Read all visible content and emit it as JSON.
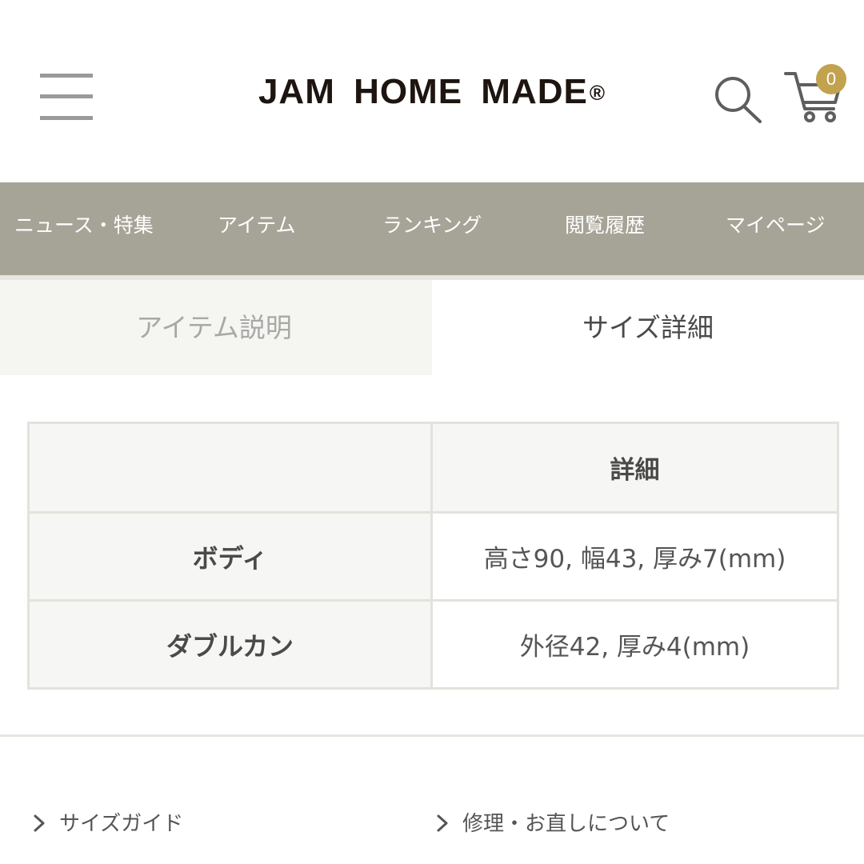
{
  "header": {
    "logo_text": "JAM HOME MADE",
    "logo_mark": "®",
    "cart_count": "0",
    "icons": [
      "hamburger-menu-icon",
      "search-icon",
      "cart-icon"
    ],
    "accent_color": "#c2a24f"
  },
  "nav": {
    "background": "#a6a497",
    "items": [
      {
        "label": "ニュース・特集"
      },
      {
        "label": "アイテム"
      },
      {
        "label": "ランキング"
      },
      {
        "label": "閲覧履歴"
      },
      {
        "label": "マイページ"
      }
    ]
  },
  "tabs": [
    {
      "label": "アイテム説明",
      "active": false
    },
    {
      "label": "サイズ詳細",
      "active": true
    }
  ],
  "size_table": {
    "header": [
      "",
      "詳細"
    ],
    "rows": [
      {
        "label": "ボディ",
        "value": "高さ90, 幅43, 厚み7(mm)"
      },
      {
        "label": "ダブルカン",
        "value": "外径42, 厚み4(mm)"
      }
    ]
  },
  "links": [
    {
      "label": "サイズガイド",
      "icon": "chevron-right-icon"
    },
    {
      "label": "修理・お直しについて",
      "icon": "chevron-right-icon"
    }
  ]
}
